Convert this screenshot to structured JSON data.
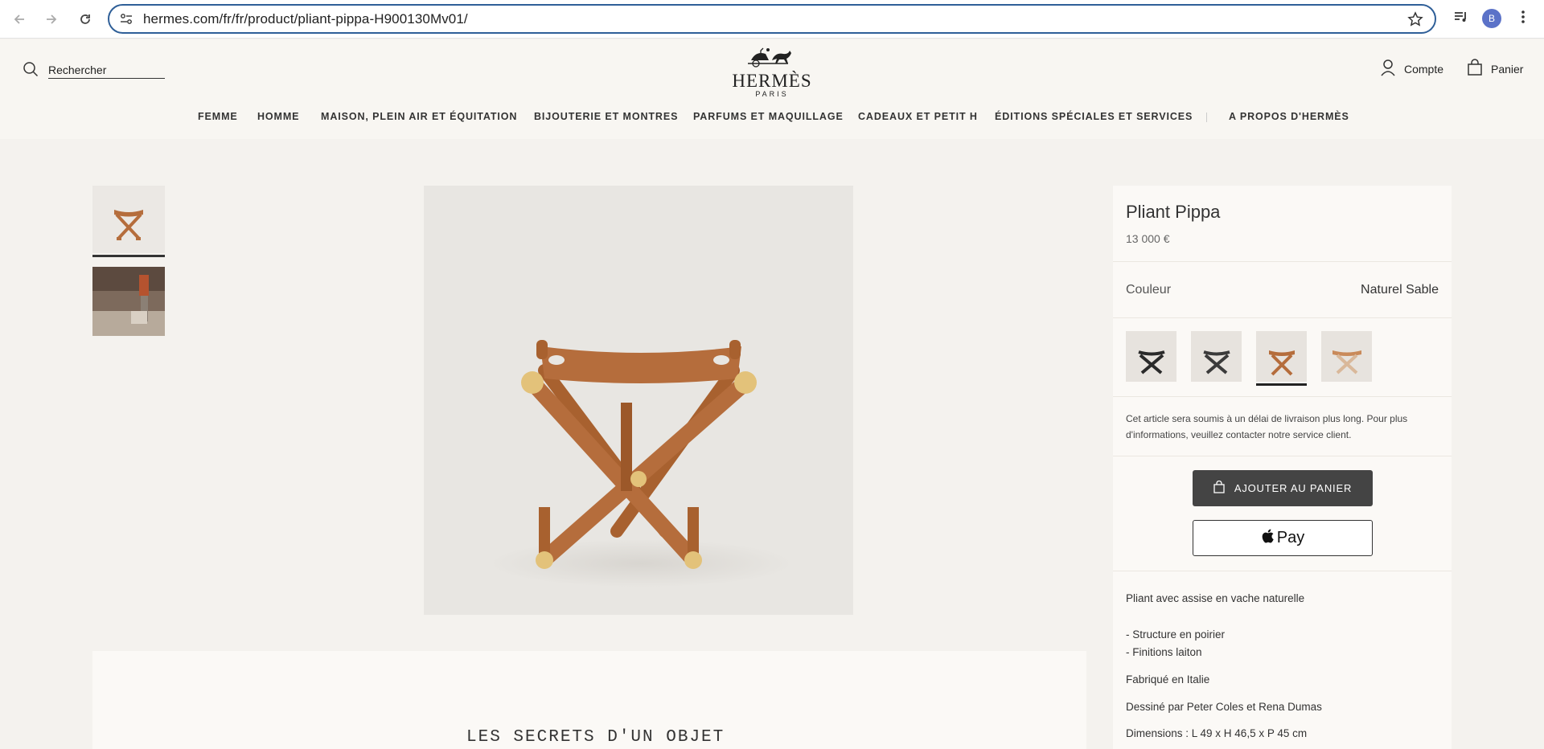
{
  "browser": {
    "url": "hermes.com/fr/fr/product/pliant-pippa-H900130Mv01/",
    "profile_initial": "B"
  },
  "header": {
    "search_label": "Rechercher",
    "brand": "HERMÈS",
    "city": "PARIS",
    "account_label": "Compte",
    "cart_label": "Panier"
  },
  "nav": {
    "items": [
      "FEMME",
      "HOMME",
      "MAISON, PLEIN AIR ET ÉQUITATION",
      "BIJOUTERIE ET MONTRES",
      "PARFUMS ET MAQUILLAGE",
      "CADEAUX ET PETIT H",
      "ÉDITIONS SPÉCIALES ET SERVICES",
      "A PROPOS D'HERMÈS"
    ]
  },
  "product": {
    "name": "Pliant Pippa",
    "price": "13 000 €",
    "color_label": "Couleur",
    "color_value": "Naturel Sable",
    "notice": "Cet article sera soumis à un délai de livraison plus long. Pour plus d'informations, veuillez contacter notre service client.",
    "add_to_cart": "AJOUTER AU PANIER",
    "apple_pay": "Pay",
    "description": {
      "intro": "Pliant avec assise en vache naturelle",
      "line1": "- Structure en poirier",
      "line2": "- Finitions laiton",
      "made_in": "Fabriqué en Italie",
      "designer": "Dessiné par Peter Coles et Rena Dumas",
      "dimensions": "Dimensions : L 49 x H 46,5 x P 45 cm"
    }
  },
  "secrets": {
    "title": "LES SECRETS D'UN OBJET"
  },
  "colors": {
    "accent_blue": "#2f5f98",
    "leather": "#b56d3c",
    "brass": "#e3c27a",
    "button_dark": "#444444"
  }
}
